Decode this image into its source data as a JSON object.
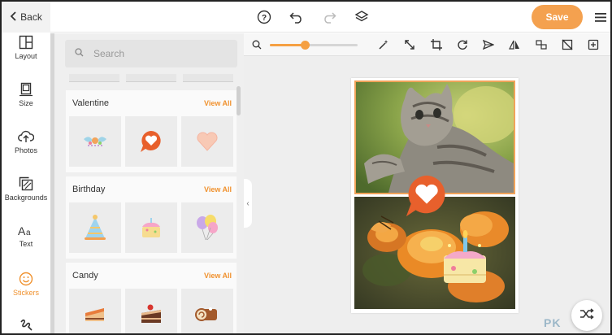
{
  "topbar": {
    "back_label": "Back",
    "save_label": "Save",
    "icons": [
      "help-icon",
      "undo-icon",
      "redo-icon",
      "layers-icon",
      "menu-icon"
    ]
  },
  "rail": {
    "items": [
      {
        "label": "Layout",
        "icon": "layout-icon"
      },
      {
        "label": "Size",
        "icon": "size-icon"
      },
      {
        "label": "Photos",
        "icon": "upload-icon"
      },
      {
        "label": "Backgrounds",
        "icon": "backgrounds-icon"
      },
      {
        "label": "Text",
        "icon": "text-icon"
      },
      {
        "label": "Stickers",
        "icon": "sticker-icon",
        "active": true
      },
      {
        "label": "",
        "icon": "draw-icon"
      }
    ]
  },
  "panel": {
    "search_placeholder": "Search",
    "sections": [
      {
        "title": "Valentine",
        "link": "View All",
        "stickers": [
          "candy-wings-sticker",
          "heart-bubble-sticker",
          "pink-heart-sticker"
        ]
      },
      {
        "title": "Birthday",
        "link": "View All",
        "stickers": [
          "party-hat-sticker",
          "cupcake-sticker",
          "balloons-sticker"
        ]
      },
      {
        "title": "Candy",
        "link": "View All",
        "stickers": [
          "cake-slice-sticker",
          "chocolate-cake-sticker",
          "swiss-roll-sticker"
        ]
      }
    ]
  },
  "toolbar": {
    "zoom_level": 0.4,
    "tools": [
      "magic-wand-icon",
      "resize-icon",
      "crop-icon",
      "rotate-icon",
      "send-icon",
      "flip-icon",
      "swap-icon",
      "remove-bg-icon",
      "add-icon"
    ]
  },
  "colors": {
    "accent": "#f4a14f",
    "panel_bg": "#efefef",
    "canvas_bg": "#eeeeee"
  },
  "watermark": "PK"
}
